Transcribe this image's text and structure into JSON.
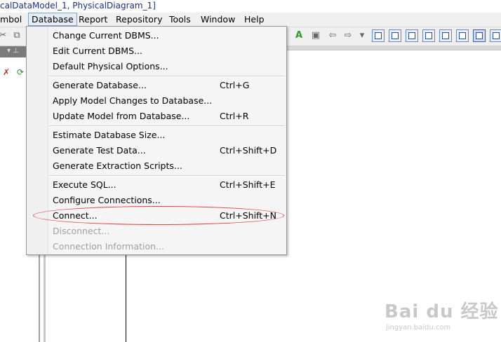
{
  "window": {
    "title": "calDataModel_1, PhysicalDiagram_1]"
  },
  "menubar": {
    "items": [
      {
        "label": "mbol"
      },
      {
        "label": "Database"
      },
      {
        "label": "Report"
      },
      {
        "label": "Repository"
      },
      {
        "label": "Tools"
      },
      {
        "label": "Window"
      },
      {
        "label": "Help"
      }
    ],
    "active": "Database"
  },
  "database_menu": {
    "groups": [
      [
        {
          "label": "Change Current DBMS...",
          "shortcut": "",
          "enabled": true
        },
        {
          "label": "Edit Current DBMS...",
          "shortcut": "",
          "enabled": true
        },
        {
          "label": "Default Physical Options...",
          "shortcut": "",
          "enabled": true
        }
      ],
      [
        {
          "label": "Generate Database...",
          "shortcut": "Ctrl+G",
          "enabled": true
        },
        {
          "label": "Apply Model Changes to Database...",
          "shortcut": "",
          "enabled": true
        },
        {
          "label": "Update Model from Database...",
          "shortcut": "Ctrl+R",
          "enabled": true
        }
      ],
      [
        {
          "label": "Estimate Database Size...",
          "shortcut": "",
          "enabled": true
        },
        {
          "label": "Generate Test Data...",
          "shortcut": "Ctrl+Shift+D",
          "enabled": true
        },
        {
          "label": "Generate Extraction Scripts...",
          "shortcut": "",
          "enabled": true
        }
      ],
      [
        {
          "label": "Execute SQL...",
          "shortcut": "Ctrl+Shift+E",
          "enabled": true
        },
        {
          "label": "Configure Connections...",
          "shortcut": "",
          "enabled": true
        },
        {
          "label": "Connect...",
          "shortcut": "Ctrl+Shift+N",
          "enabled": true
        },
        {
          "label": "Disconnect...",
          "shortcut": "",
          "enabled": false
        },
        {
          "label": "Connection Information...",
          "shortcut": "",
          "enabled": false
        }
      ]
    ],
    "highlighted_item": "Connect..."
  },
  "colors": {
    "menu_active_border": "#7da2ce",
    "highlight_oval": "#e0403e",
    "title_text": "#1a2f8a"
  },
  "watermark": {
    "brand": "Bai du 经验",
    "url": "jingyan.baidu.com"
  }
}
